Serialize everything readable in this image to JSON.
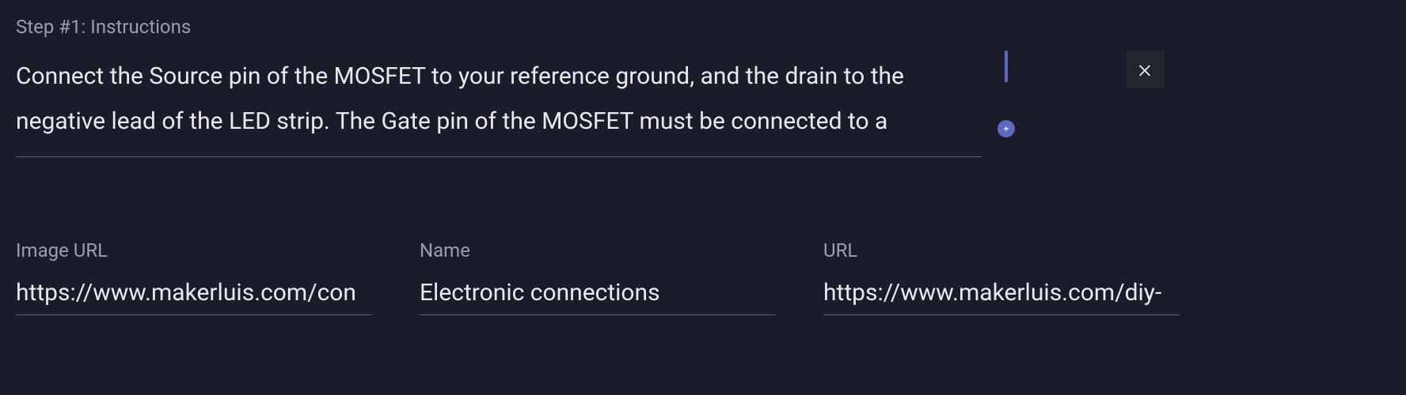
{
  "step": {
    "label": "Step #1: Instructions",
    "instructions_value": "Connect the Source pin of the MOSFET to your reference ground, and the drain to the negative lead of the LED strip. The Gate pin of the MOSFET must be connected to a"
  },
  "fields": {
    "image_url": {
      "label": "Image URL",
      "value": "https://www.makerluis.com/con"
    },
    "name": {
      "label": "Name",
      "value": "Electronic connections"
    },
    "url": {
      "label": "URL",
      "value": "https://www.makerluis.com/diy-"
    }
  },
  "colors": {
    "background": "#1a1d29",
    "text_muted": "#9aa0a6",
    "text_primary": "#e8eaed",
    "accent": "#5c6bc0",
    "border": "#5f6368"
  }
}
